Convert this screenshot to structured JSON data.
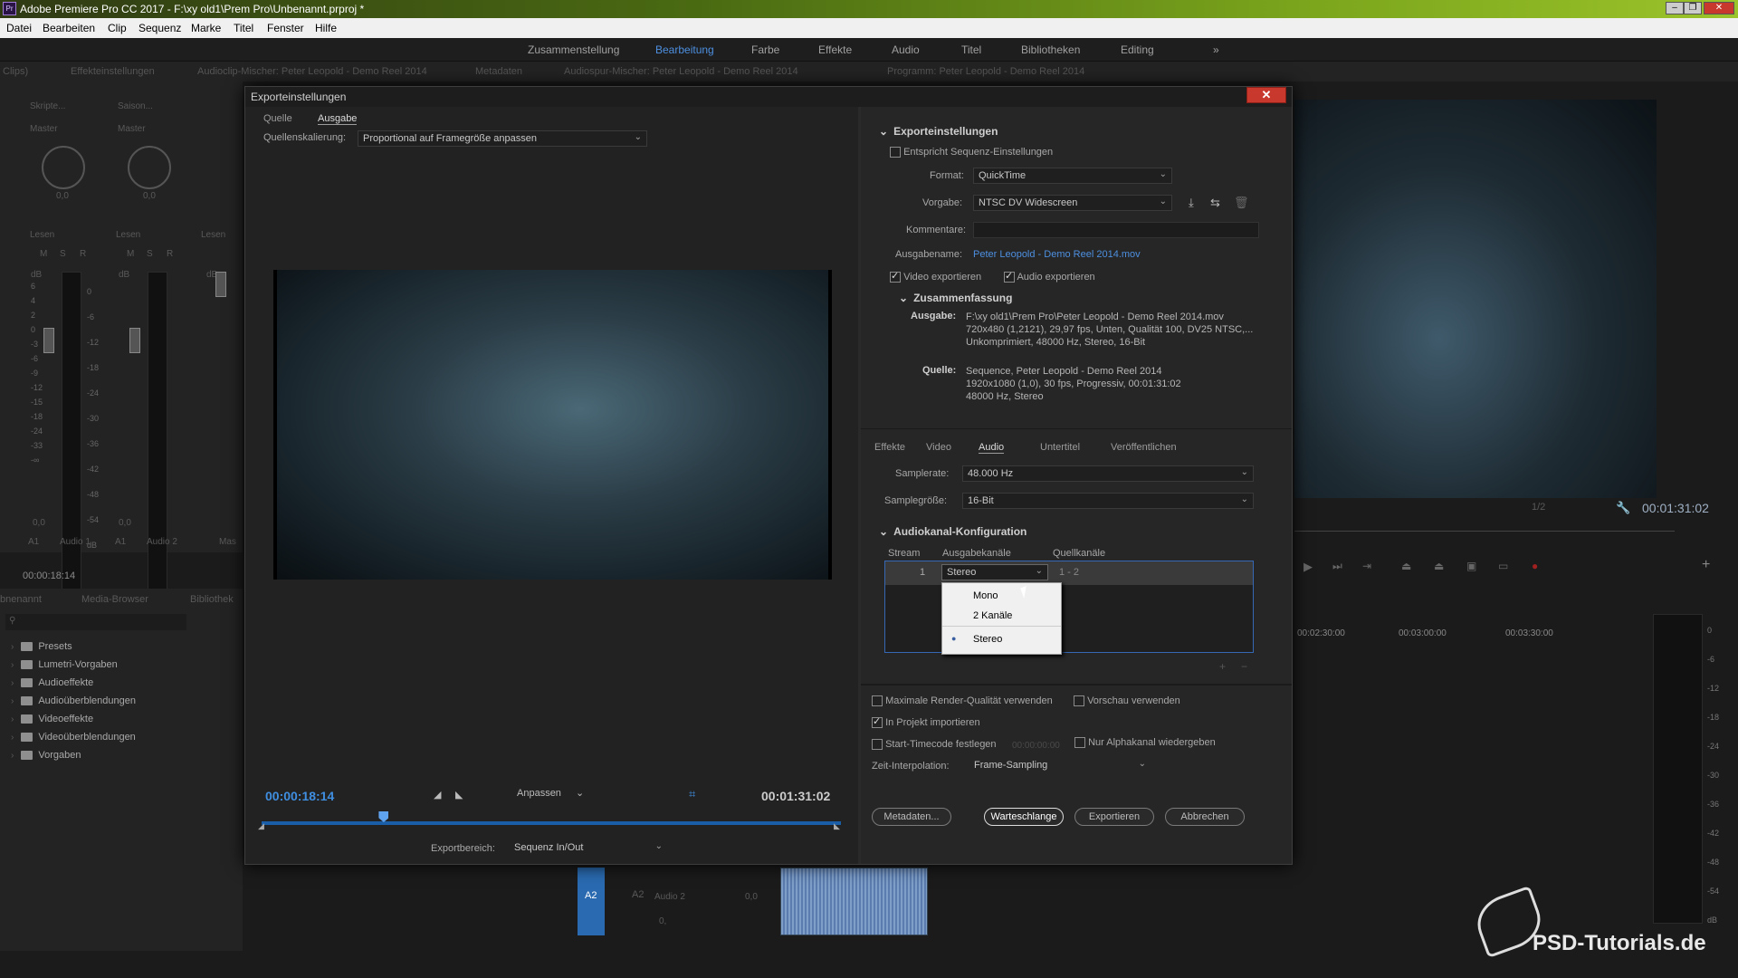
{
  "app": {
    "title": "Adobe Premiere Pro CC 2017 - F:\\xy old1\\Prem Pro\\Unbenannt.prproj *",
    "icon": "premiere-pro-icon"
  },
  "menu": [
    "Datei",
    "Bearbeiten",
    "Clip",
    "Sequenz",
    "Marke",
    "Titel",
    "Fenster",
    "Hilfe"
  ],
  "workspaces": [
    "Zusammenstellung",
    "Bearbeitung",
    "Farbe",
    "Effekte",
    "Audio",
    "Titel",
    "Bibliotheken",
    "Editing"
  ],
  "panel_tabs": [
    "Clips)",
    "Effekteinstellungen",
    "Audioclip-Mischer: Peter Leopold - Demo Reel 2014",
    "Metadaten",
    "Audiospur-Mischer: Peter Leopold - Demo Reel 2014",
    "Programm: Peter Leopold - Demo Reel 2014"
  ],
  "mixer": {
    "ch1": "Skripte...",
    "ch2": "Saison...",
    "master": "Master",
    "mode": "Lesen",
    "msr": [
      "M",
      "S",
      "R"
    ],
    "db": "dB",
    "val": "0,0",
    "tracks": [
      "A1",
      "Audio 1",
      "A1",
      "Audio 2",
      "Mas"
    ],
    "timecode": "00:00:18:14",
    "scale": [
      "6",
      "4",
      "2",
      "0",
      "-3",
      "-6",
      "-9",
      "-12",
      "-15",
      "-18",
      "-24",
      "-33",
      "-∞"
    ],
    "scale2": [
      "0",
      "-6",
      "-12",
      "-18",
      "-24",
      "-30",
      "-36",
      "-42",
      "-48",
      "-54",
      "dB"
    ]
  },
  "project": {
    "tabs": [
      "bnenannt",
      "Media-Browser",
      "Bibliothek"
    ],
    "items": [
      "Presets",
      "Lumetri-Vorgaben",
      "Audioeffekte",
      "Audioüberblendungen",
      "Videoeffekte",
      "Videoüberblendungen",
      "Vorgaben"
    ]
  },
  "program": {
    "zoom": "1/2",
    "timecode": "00:01:31:02",
    "ruler": [
      "00:02:30:00",
      "00:03:00:00",
      "00:03:30:00"
    ],
    "meter_scale": [
      "0",
      "-6",
      "-12",
      "-18",
      "-24",
      "-30",
      "-36",
      "-42",
      "-48",
      "-54",
      "dB"
    ]
  },
  "timeline": {
    "track_a2": "A2",
    "track_label": "A2",
    "track_name": "Audio 2",
    "val": "0,0",
    "level": "0,"
  },
  "watermark": "PSD-Tutorials.de",
  "dialog": {
    "title": "Exporteinstellungen",
    "close": "✕",
    "left_tabs": [
      "Quelle",
      "Ausgabe"
    ],
    "scaling_label": "Quellenskalierung:",
    "scaling_value": "Proportional auf Framegröße anpassen",
    "current_tc": "00:00:18:14",
    "fit": "Anpassen",
    "duration_tc": "00:01:31:02",
    "range_label": "Exportbereich:",
    "range_value": "Sequenz In/Out",
    "playhead_fraction": 0.21,
    "export_settings": {
      "heading": "Exporteinstellungen",
      "match_seq": "Entspricht Sequenz-Einstellungen",
      "format_label": "Format:",
      "format_value": "QuickTime",
      "preset_label": "Vorgabe:",
      "preset_value": "NTSC DV Widescreen",
      "comments_label": "Kommentare:",
      "comments_value": "",
      "outname_label": "Ausgabename:",
      "outname_value": "Peter Leopold - Demo Reel 2014.mov",
      "video_export": "Video exportieren",
      "audio_export": "Audio exportieren",
      "summary_heading": "Zusammenfassung",
      "out_label": "Ausgabe:",
      "out_lines": [
        "F:\\xy old1\\Prem Pro\\Peter Leopold - Demo Reel 2014.mov",
        "720x480 (1,2121), 29,97 fps, Unten, Qualität 100, DV25 NTSC,...",
        "Unkomprimiert, 48000 Hz, Stereo, 16-Bit"
      ],
      "src_label": "Quelle:",
      "src_lines": [
        "Sequence, Peter Leopold - Demo Reel 2014",
        "1920x1080 (1,0), 30 fps, Progressiv, 00:01:31:02",
        "48000 Hz, Stereo"
      ]
    },
    "right_tabs": [
      "Effekte",
      "Video",
      "Audio",
      "Untertitel",
      "Veröffentlichen"
    ],
    "samplerate_label": "Samplerate:",
    "samplerate_value": "48.000 Hz",
    "samplesize_label": "Samplegröße:",
    "samplesize_value": "16-Bit",
    "channel_heading": "Audiokanal-Konfiguration",
    "cols": [
      "Stream",
      "Ausgabekanäle",
      "Quellkanäle"
    ],
    "row": {
      "stream": "1",
      "out": "Stereo",
      "src": "1 - 2"
    },
    "dropdown": [
      "Mono",
      "2 Kanäle",
      "Stereo"
    ],
    "dropdown_selected": "Stereo",
    "opts": {
      "max_render": "Maximale Render-Qualität verwenden",
      "preview": "Vorschau verwenden",
      "import": "In Projekt importieren",
      "start_tc": "Start-Timecode festlegen",
      "start_tc_value": "00:00:00:00",
      "alpha": "Nur Alphakanal wiedergeben",
      "interp_label": "Zeit-Interpolation:",
      "interp_value": "Frame-Sampling"
    },
    "buttons": [
      "Metadaten...",
      "Warteschlange",
      "Exportieren",
      "Abbrechen"
    ],
    "plusminus": [
      "+",
      "−"
    ]
  }
}
